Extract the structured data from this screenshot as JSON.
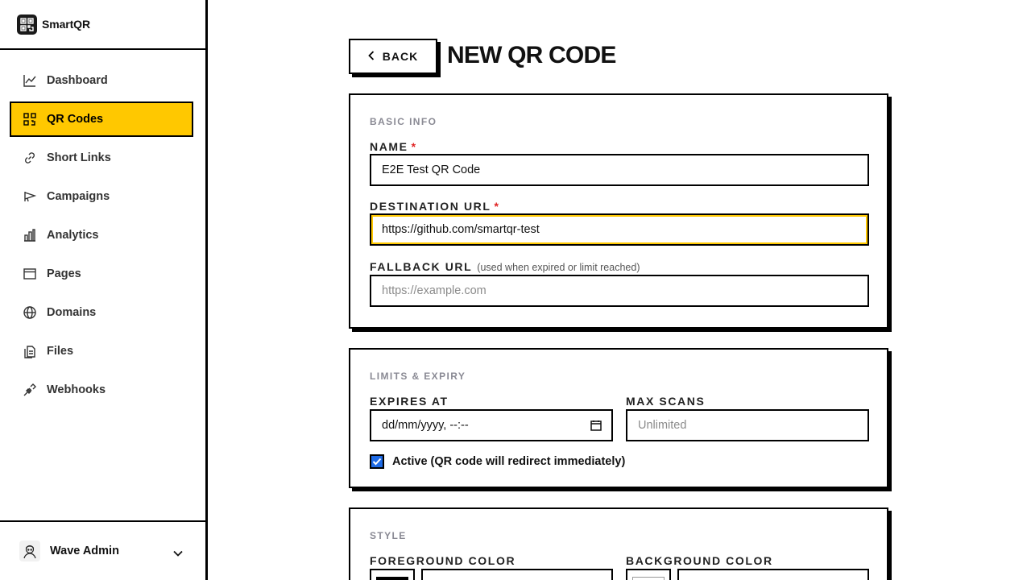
{
  "app": {
    "name": "SmartQR"
  },
  "sidebar": {
    "items": [
      {
        "label": "Dashboard",
        "icon": "chart-line-icon"
      },
      {
        "label": "QR Codes",
        "icon": "qr-icon",
        "active": true
      },
      {
        "label": "Short Links",
        "icon": "link-icon"
      },
      {
        "label": "Campaigns",
        "icon": "megaphone-icon"
      },
      {
        "label": "Analytics",
        "icon": "bar-chart-icon"
      },
      {
        "label": "Pages",
        "icon": "browser-icon"
      },
      {
        "label": "Domains",
        "icon": "globe-icon"
      },
      {
        "label": "Files",
        "icon": "files-icon"
      },
      {
        "label": "Webhooks",
        "icon": "webhook-icon"
      }
    ],
    "user": {
      "name": "Wave Admin"
    }
  },
  "header": {
    "back_label": "BACK",
    "title": "NEW QR CODE"
  },
  "basic_info": {
    "section_title": "BASIC INFO",
    "name_label": "NAME",
    "name_value": "E2E Test QR Code",
    "destination_label": "DESTINATION URL",
    "destination_value": "https://github.com/smartqr-test",
    "fallback_label": "FALLBACK URL",
    "fallback_hint": "(used when expired or limit reached)",
    "fallback_placeholder": "https://example.com",
    "required_mark": "*"
  },
  "limits": {
    "section_title": "LIMITS & EXPIRY",
    "expires_label": "EXPIRES AT",
    "expires_placeholder": "dd/mm/yyyy, --:--",
    "max_scans_label": "MAX SCANS",
    "max_scans_placeholder": "Unlimited",
    "active_label": "Active (QR code will redirect immediately)",
    "active_checked": true
  },
  "style": {
    "section_title": "STYLE",
    "foreground_label": "FOREGROUND COLOR",
    "background_label": "BACKGROUND COLOR",
    "foreground_color": "#000000",
    "background_color": "#ffffff"
  },
  "colors": {
    "accent": "#ffc800",
    "checkbox": "#1e6be6",
    "required": "#e02424"
  }
}
